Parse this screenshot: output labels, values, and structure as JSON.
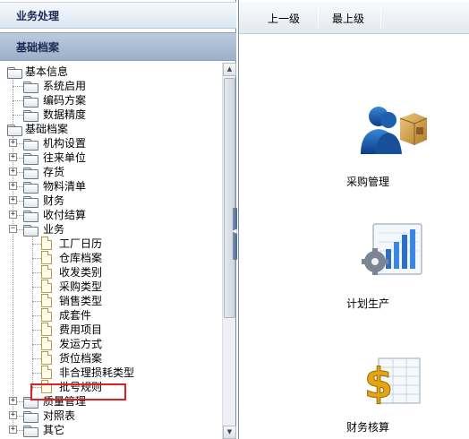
{
  "left_panel": {
    "header_business": "业务处理",
    "header_basic": "基础档案"
  },
  "tree": [
    {
      "label": "基本信息",
      "level": 0,
      "kind": "folder",
      "expanded": true
    },
    {
      "label": "系统启用",
      "level": 1,
      "kind": "folder"
    },
    {
      "label": "编码方案",
      "level": 1,
      "kind": "folder"
    },
    {
      "label": "数据精度",
      "level": 1,
      "kind": "folder"
    },
    {
      "label": "基础档案",
      "level": 0,
      "kind": "folder",
      "expanded": true
    },
    {
      "label": "机构设置",
      "level": 1,
      "kind": "folder",
      "expandable": true
    },
    {
      "label": "往来单位",
      "level": 1,
      "kind": "folder",
      "expandable": true
    },
    {
      "label": "存货",
      "level": 1,
      "kind": "folder",
      "expandable": true
    },
    {
      "label": "物料清单",
      "level": 1,
      "kind": "folder",
      "expandable": true
    },
    {
      "label": "财务",
      "level": 1,
      "kind": "folder",
      "expandable": true
    },
    {
      "label": "收付结算",
      "level": 1,
      "kind": "folder",
      "expandable": true
    },
    {
      "label": "业务",
      "level": 1,
      "kind": "folder",
      "expandable": true,
      "expanded": true
    },
    {
      "label": "工厂日历",
      "level": 2,
      "kind": "doc"
    },
    {
      "label": "仓库档案",
      "level": 2,
      "kind": "doc"
    },
    {
      "label": "收发类别",
      "level": 2,
      "kind": "doc"
    },
    {
      "label": "采购类型",
      "level": 2,
      "kind": "doc"
    },
    {
      "label": "销售类型",
      "level": 2,
      "kind": "doc"
    },
    {
      "label": "成套件",
      "level": 2,
      "kind": "doc"
    },
    {
      "label": "费用项目",
      "level": 2,
      "kind": "doc",
      "highlighted": true
    },
    {
      "label": "发运方式",
      "level": 2,
      "kind": "doc"
    },
    {
      "label": "货位档案",
      "level": 2,
      "kind": "doc"
    },
    {
      "label": "非合理损耗类型",
      "level": 2,
      "kind": "doc"
    },
    {
      "label": "批号规则",
      "level": 2,
      "kind": "doc"
    },
    {
      "label": "质量管理",
      "level": 1,
      "kind": "folder",
      "expandable": true
    },
    {
      "label": "对照表",
      "level": 1,
      "kind": "folder",
      "expandable": true
    },
    {
      "label": "其它",
      "level": 1,
      "kind": "folder",
      "expandable": true
    }
  ],
  "toolbar": {
    "up_label": "上一级",
    "top_label": "最上级"
  },
  "modules": [
    {
      "label": "采购管理",
      "icon": "purchasing-people-box-icon"
    },
    {
      "label": "计划生产",
      "icon": "production-chart-gear-icon"
    },
    {
      "label": "财务核算",
      "icon": "finance-dollar-ledger-icon"
    }
  ],
  "colors": {
    "highlight_border": "#e02020",
    "header_dark": "#1a2a55",
    "splitter": "#4a6690"
  }
}
